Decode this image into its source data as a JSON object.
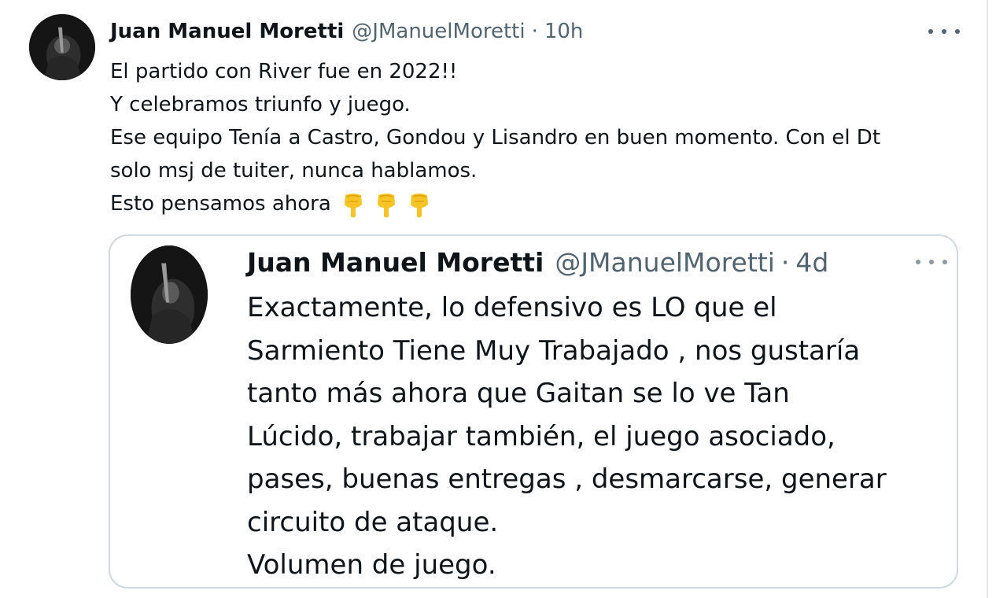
{
  "tweet": {
    "author_name": "Juan Manuel Moretti",
    "author_handle": "@JManuelMoretti",
    "separator": "·",
    "time": "10h",
    "lines": [
      "El partido con River fue en 2022!!",
      "Y celebramos triunfo y juego.",
      "Ese equipo Tenía a Castro, Gondou y Lisandro en buen momento. Con el Dt",
      "solo msj de tuiter, nunca hablamos.",
      "Esto pensamos ahora"
    ],
    "emojis": [
      "backhand-index-pointing-down",
      "backhand-index-pointing-down",
      "backhand-index-pointing-down"
    ]
  },
  "quoted_tweet": {
    "author_name": "Juan Manuel Moretti",
    "author_handle": "@JManuelMoretti",
    "separator": "·",
    "time": "4d",
    "lines": [
      "Exactamente, lo defensivo es LO que el",
      "Sarmiento Tiene Muy Trabajado , nos gustaría",
      "tanto más ahora que Gaitan se lo ve Tan",
      "Lúcido, trabajar también, el juego asociado,",
      "pases, buenas entregas , desmarcarse, generar",
      "circuito de ataque.",
      "Volumen de juego."
    ]
  },
  "colors": {
    "text_primary": "#0f1419",
    "text_secondary": "#536471",
    "border": "#cfd9de",
    "emoji": "#f7c325"
  }
}
